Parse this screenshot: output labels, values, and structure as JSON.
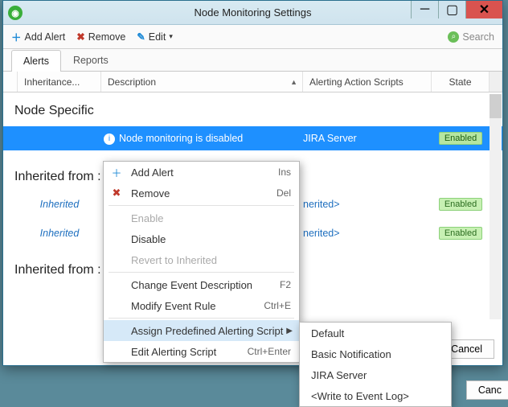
{
  "window": {
    "title": "Node Monitoring Settings"
  },
  "toolbar": {
    "add": "Add Alert",
    "remove": "Remove",
    "edit": "Edit"
  },
  "search": {
    "placeholder": "Search"
  },
  "tabs": {
    "alerts": "Alerts",
    "reports": "Reports"
  },
  "columns": {
    "inheritance": "Inheritance...",
    "description": "Description",
    "action": "Alerting Action Scripts",
    "state": "State"
  },
  "groups": {
    "node_specific": "Node Specific",
    "inherited_from_1": "Inherited from :",
    "inherited_from_2": "Inherited from :"
  },
  "rows": {
    "r0": {
      "desc": "Node monitoring is disabled",
      "action": "JIRA Server",
      "state": "Enabled"
    },
    "r1": {
      "inh": "Inherited",
      "action_suffix": "nerited>",
      "state": "Enabled"
    },
    "r2": {
      "inh": "Inherited",
      "action_suffix": "nerited>",
      "state": "Enabled"
    }
  },
  "context": {
    "add": "Add Alert",
    "add_sc": "Ins",
    "remove": "Remove",
    "remove_sc": "Del",
    "enable": "Enable",
    "disable": "Disable",
    "revert": "Revert to Inherited",
    "change": "Change Event Description",
    "change_sc": "F2",
    "modify": "Modify Event Rule",
    "modify_sc": "Ctrl+E",
    "assign": "Assign Predefined Alerting Script",
    "edit": "Edit Alerting Script",
    "edit_sc": "Ctrl+Enter"
  },
  "submenu": {
    "s0": "Default",
    "s1": "Basic Notification",
    "s2": "JIRA Server",
    "s3": "<Write to Event Log>"
  },
  "buttons": {
    "cancel": "Cancel",
    "outer_cancel": "Canc"
  }
}
